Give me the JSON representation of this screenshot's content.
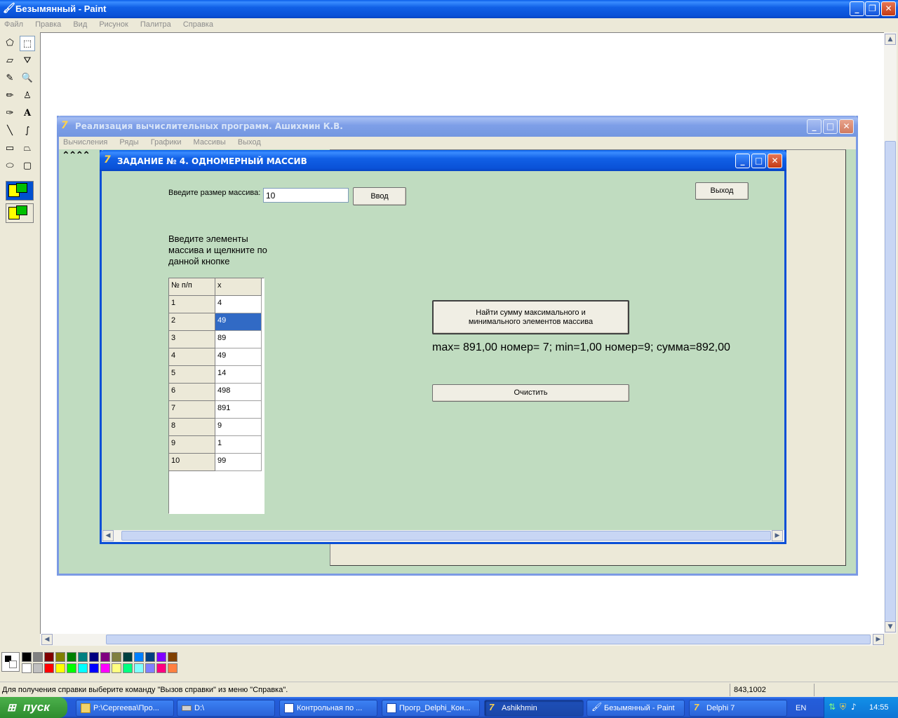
{
  "paint": {
    "title": "Безымянный - Paint",
    "menu": [
      "Файл",
      "Правка",
      "Вид",
      "Рисунок",
      "Палитра",
      "Справка"
    ],
    "status_text": "Для получения справки выберите команду \"Вызов справки\" из меню \"Справка\".",
    "status_coords": "843,1002",
    "palette_row1": [
      "#000000",
      "#808080",
      "#800000",
      "#808000",
      "#008000",
      "#008080",
      "#000080",
      "#800080",
      "#808040",
      "#004040",
      "#0080FF",
      "#004080",
      "#8000FF",
      "#804000"
    ],
    "palette_row2": [
      "#FFFFFF",
      "#C0C0C0",
      "#FF0000",
      "#FFFF00",
      "#00FF00",
      "#00FFFF",
      "#0000FF",
      "#FF00FF",
      "#FFFF80",
      "#00FF80",
      "#80FFFF",
      "#8080FF",
      "#FF0080",
      "#FF8040"
    ]
  },
  "main_window": {
    "title": "Реализация вычислительных программ. Ашихмин К.В.",
    "menu": [
      "Вычисления",
      "Ряды",
      "Графики",
      "Массивы",
      "Выход"
    ]
  },
  "dialog": {
    "title": "ЗАДАНИЕ № 4. ОДНОМЕРНЫЙ МАССИВ",
    "size_label": "Введите размер массива:",
    "size_value": "10",
    "enter_button": "Ввод",
    "exit_button": "Выход",
    "instruction": "Введите элементы массива и щелкните по данной кнопке",
    "grid_headers": [
      "№ п/п",
      "x"
    ],
    "grid_rows": [
      [
        "1",
        "4"
      ],
      [
        "2",
        "49"
      ],
      [
        "3",
        "89"
      ],
      [
        "4",
        "49"
      ],
      [
        "5",
        "14"
      ],
      [
        "6",
        "498"
      ],
      [
        "7",
        "891"
      ],
      [
        "8",
        "9"
      ],
      [
        "9",
        "1"
      ],
      [
        "10",
        "99"
      ]
    ],
    "selected_row": 2,
    "find_button": "Найти сумму максимального и минимального элементов массива",
    "result": "max=  891,00 номер= 7; min=1,00 номер=9; сумма=892,00",
    "clear_button": "Очистить"
  },
  "taskbar": {
    "start": "пуск",
    "items": [
      "P:\\Сергеева\\Про...",
      "D:\\",
      "Контрольная по ...",
      "Прогр_Delphi_Кон...",
      "Ashikhmin",
      "Безымянный - Paint",
      "Delphi 7"
    ],
    "lang": "EN",
    "clock": "14:55"
  }
}
